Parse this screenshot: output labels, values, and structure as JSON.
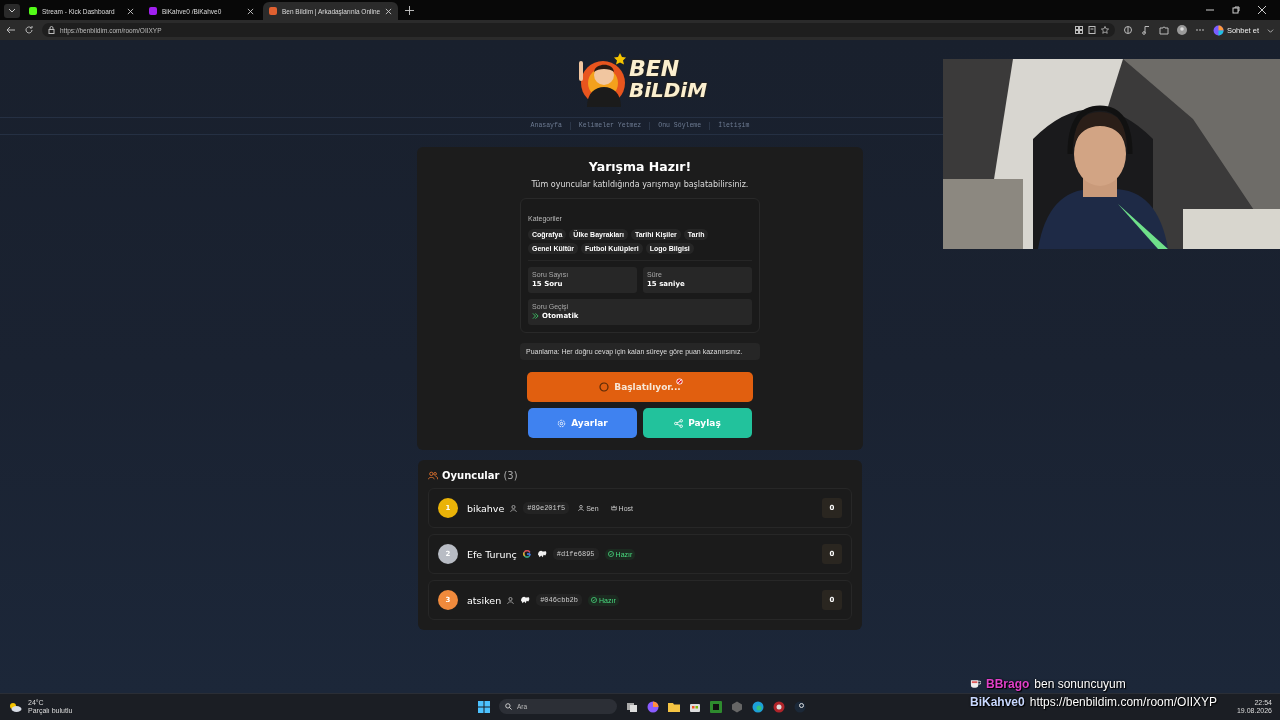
{
  "browser": {
    "tabs": [
      {
        "label": "Stream - Kick Dashboard",
        "selected": false,
        "color": "#53fc18"
      },
      {
        "label": "BiKahve0 /BiKahve0",
        "selected": false,
        "color": "#a020f0"
      },
      {
        "label": "Ben Bildim | Arkadaşlarınla Online",
        "selected": true,
        "color": "#e06030"
      }
    ],
    "url": "https://benbildim.com/room/OIIXYP",
    "chat_button": "Sohbet et"
  },
  "site": {
    "logo": [
      "BEN",
      "BiLDiM"
    ],
    "nav": [
      "Anasayfa",
      "Kelimeler Yetmez",
      "Onu Söyleme",
      "İletişim"
    ]
  },
  "lobby": {
    "title": "Yarışma Hazır!",
    "subtitle": "Tüm oyuncular katıldığında yarışmayı başlatabilirsiniz.",
    "categories_label": "Kategoriler",
    "categories": [
      "Coğrafya",
      "Ülke Bayrakları",
      "Tarihi Kişiler",
      "Tarih",
      "Genel Kültür",
      "Futbol Kulüpleri",
      "Logo Bilgisi"
    ],
    "settings": [
      {
        "kind": "plain",
        "label": "Soru Sayısı",
        "value": "15 Soru"
      },
      {
        "kind": "plain",
        "label": "Süre",
        "value": "15 saniye"
      },
      {
        "kind": "auto",
        "label": "Soru Geçişi",
        "value": "Otomatik"
      }
    ],
    "scoring_note": "Puanlama: Her doğru cevap için kalan süreye göre puan kazanırsınız.",
    "start_button": {
      "label": "Başlatılıyor...",
      "loading": true
    },
    "settings_button": "Ayarlar",
    "share_button": "Paylaş"
  },
  "players": {
    "title": "Oyuncular",
    "count": "(3)",
    "list": [
      {
        "rank": "1",
        "color": "#eab308",
        "name": "bikahve",
        "kind": "guest",
        "avatar": false,
        "id": "#89e201f5",
        "tags": [
          {
            "kind": "you",
            "label": "Sen"
          },
          {
            "kind": "host",
            "label": "Host"
          }
        ],
        "score": "0"
      },
      {
        "rank": "2",
        "color": "#b8bcc4",
        "name": "Efe Turunç",
        "kind": "google",
        "avatar": true,
        "id": "#d1fe6895",
        "tags": [
          {
            "kind": "ready",
            "label": "Hazır"
          }
        ],
        "score": "0"
      },
      {
        "rank": "3",
        "color": "#f08a3c",
        "name": "atsiken",
        "kind": "guest",
        "avatar": true,
        "id": "#046cbb2b",
        "tags": [
          {
            "kind": "ready",
            "label": "Hazır"
          }
        ],
        "score": "0"
      }
    ]
  },
  "stream_chat": [
    {
      "user": "BBrago",
      "color": "#e040c8",
      "text": "ben sonuncuyum",
      "badge": true
    },
    {
      "user": "BiKahve0",
      "color": "#c8d8ff",
      "text": "https://benbildim.com/room/OIIXYP",
      "badge": false
    }
  ],
  "taskbar": {
    "temperature": "24°C",
    "weather": "Parçalı bulutlu",
    "search_placeholder": "Ara",
    "time": "22:54",
    "date": "19.08.2026"
  }
}
